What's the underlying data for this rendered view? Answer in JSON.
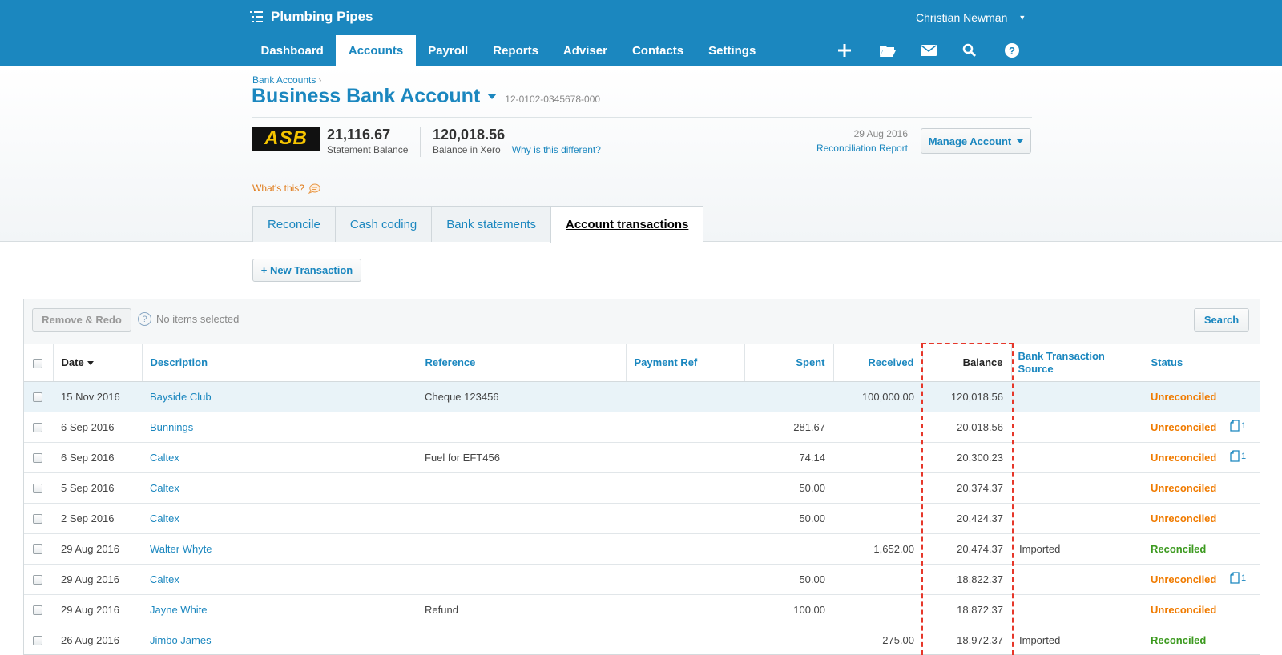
{
  "app": {
    "org_name": "Plumbing Pipes",
    "user_name": "Christian Newman",
    "brand_color": "#1b87bf"
  },
  "nav": {
    "items": [
      {
        "label": "Dashboard"
      },
      {
        "label": "Accounts"
      },
      {
        "label": "Payroll"
      },
      {
        "label": "Reports"
      },
      {
        "label": "Adviser"
      },
      {
        "label": "Contacts"
      },
      {
        "label": "Settings"
      }
    ],
    "active": "Accounts",
    "icons": [
      "plus-icon",
      "folder-icon",
      "mail-icon",
      "search-icon",
      "help-icon"
    ]
  },
  "header": {
    "breadcrumb": "Bank Accounts",
    "breadcrumb_sep": "›",
    "account_name": "Business Bank Account",
    "account_number": "12-0102-0345678-000",
    "bank_logo": "ASB",
    "statement_balance": "21,116.67",
    "statement_balance_label": "Statement Balance",
    "xero_balance": "120,018.56",
    "xero_balance_label": "Balance in Xero",
    "why_link": "Why is this different?",
    "reconcile_date": "29 Aug 2016",
    "reconcile_report": "Reconciliation Report",
    "manage_label": "Manage Account",
    "whats_this": "What's this?"
  },
  "tabs": [
    {
      "label": "Reconcile"
    },
    {
      "label": "Cash coding"
    },
    {
      "label": "Bank statements"
    },
    {
      "label": "Account transactions"
    }
  ],
  "actions": {
    "new_transaction": "+ New Transaction",
    "remove_redo": "Remove & Redo",
    "no_items": "No items selected",
    "search": "Search"
  },
  "table": {
    "headers": {
      "date": "Date",
      "description": "Description",
      "reference": "Reference",
      "payment_ref": "Payment Ref",
      "spent": "Spent",
      "received": "Received",
      "balance": "Balance",
      "source": "Bank Transaction Source",
      "status": "Status"
    },
    "rows": [
      {
        "date": "15 Nov 2016",
        "description": "Bayside Club",
        "reference": "Cheque 123456",
        "payment_ref": "",
        "spent": "",
        "received": "100,000.00",
        "balance": "120,018.56",
        "source": "",
        "status": "Unreconciled",
        "attachments": ""
      },
      {
        "date": "6 Sep 2016",
        "description": "Bunnings",
        "reference": "",
        "payment_ref": "",
        "spent": "281.67",
        "received": "",
        "balance": "20,018.56",
        "source": "",
        "status": "Unreconciled",
        "attachments": "1"
      },
      {
        "date": "6 Sep 2016",
        "description": "Caltex",
        "reference": "Fuel for EFT456",
        "payment_ref": "",
        "spent": "74.14",
        "received": "",
        "balance": "20,300.23",
        "source": "",
        "status": "Unreconciled",
        "attachments": "1"
      },
      {
        "date": "5 Sep 2016",
        "description": "Caltex",
        "reference": "",
        "payment_ref": "",
        "spent": "50.00",
        "received": "",
        "balance": "20,374.37",
        "source": "",
        "status": "Unreconciled",
        "attachments": ""
      },
      {
        "date": "2 Sep 2016",
        "description": "Caltex",
        "reference": "",
        "payment_ref": "",
        "spent": "50.00",
        "received": "",
        "balance": "20,424.37",
        "source": "",
        "status": "Unreconciled",
        "attachments": ""
      },
      {
        "date": "29 Aug 2016",
        "description": "Walter Whyte",
        "reference": "",
        "payment_ref": "",
        "spent": "",
        "received": "1,652.00",
        "balance": "20,474.37",
        "source": "Imported",
        "status": "Reconciled",
        "attachments": ""
      },
      {
        "date": "29 Aug 2016",
        "description": "Caltex",
        "reference": "",
        "payment_ref": "",
        "spent": "50.00",
        "received": "",
        "balance": "18,822.37",
        "source": "",
        "status": "Unreconciled",
        "attachments": "1"
      },
      {
        "date": "29 Aug 2016",
        "description": "Jayne White",
        "reference": "Refund",
        "payment_ref": "",
        "spent": "100.00",
        "received": "",
        "balance": "18,872.37",
        "source": "",
        "status": "Unreconciled",
        "attachments": ""
      },
      {
        "date": "26 Aug 2016",
        "description": "Jimbo James",
        "reference": "",
        "payment_ref": "",
        "spent": "",
        "received": "275.00",
        "balance": "18,972.37",
        "source": "Imported",
        "status": "Reconciled",
        "attachments": ""
      }
    ]
  },
  "colors": {
    "unreconciled": "#f07b00",
    "reconciled": "#3c9a1f",
    "highlight_box": "#e6372a"
  }
}
